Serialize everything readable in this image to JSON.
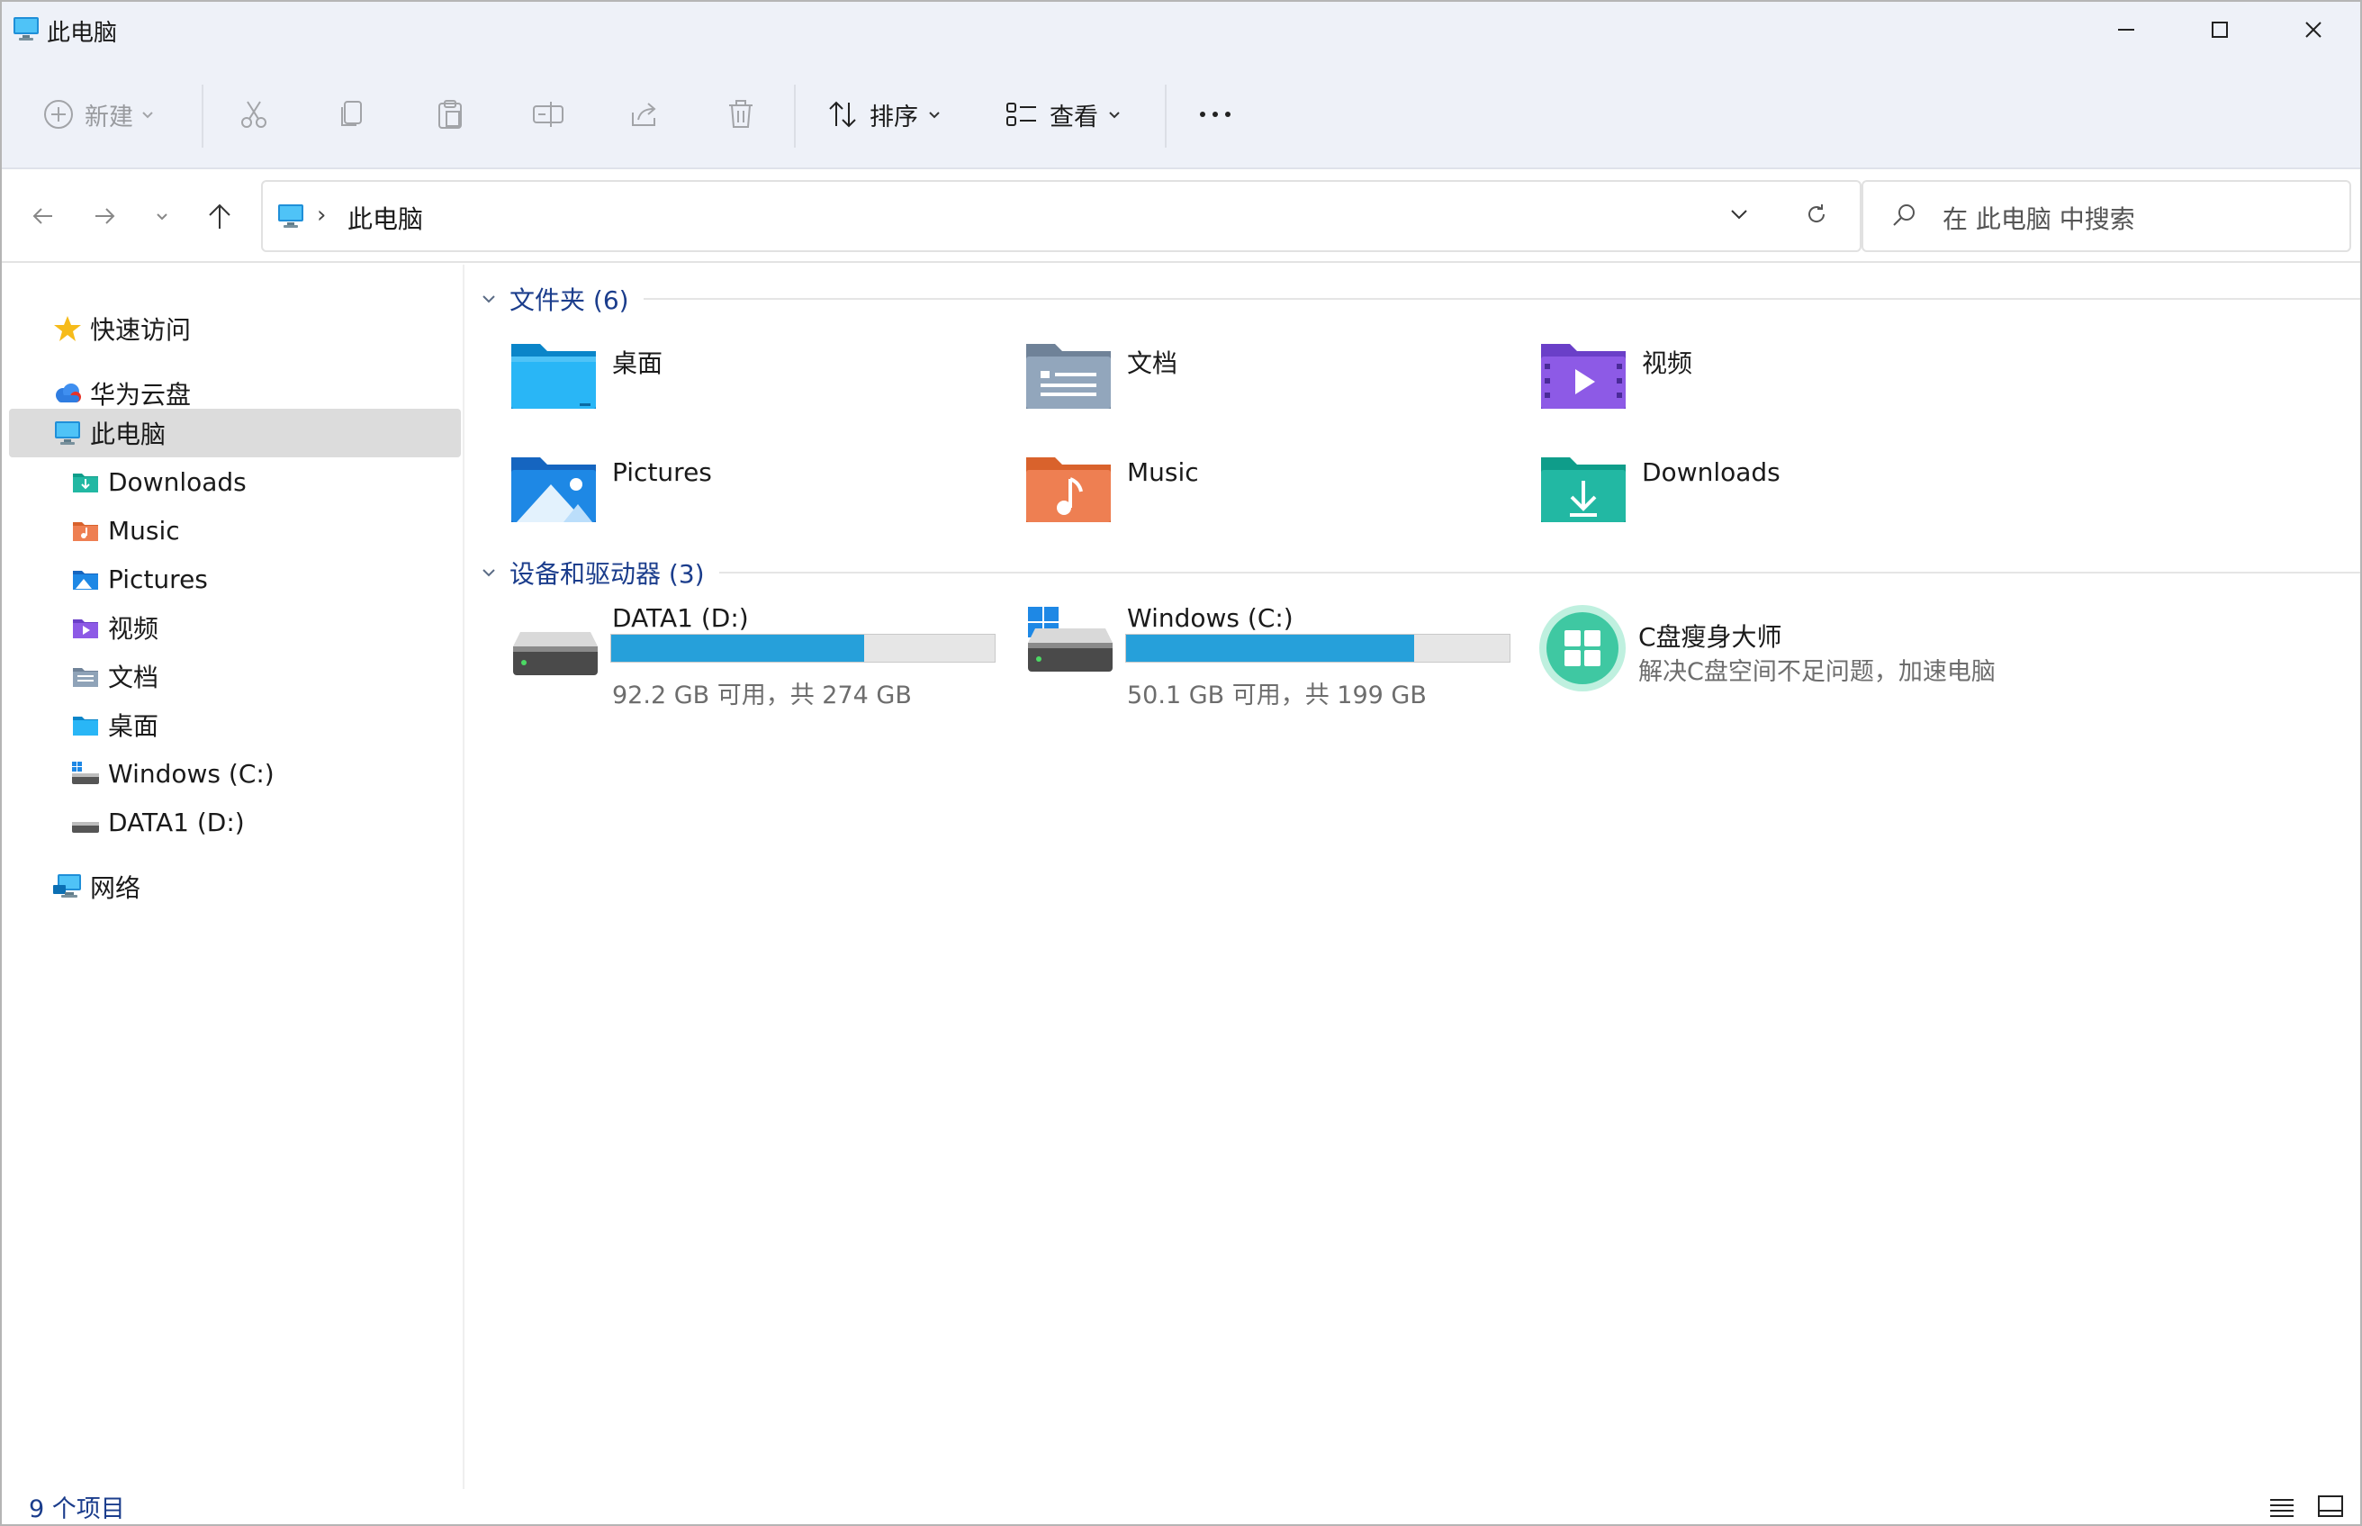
{
  "window": {
    "title": "此电脑"
  },
  "toolbar": {
    "new_label": "新建",
    "sort_label": "排序",
    "view_label": "查看"
  },
  "address": {
    "path": "此电脑"
  },
  "search": {
    "placeholder": "在 此电脑 中搜索"
  },
  "sidebar": {
    "items": [
      {
        "label": "快速访问",
        "icon": "star-icon"
      },
      {
        "label": "华为云盘",
        "icon": "cloud-icon"
      },
      {
        "label": "此电脑",
        "icon": "computer-icon",
        "selected": true
      },
      {
        "label": "Downloads",
        "icon": "downloads-folder-icon"
      },
      {
        "label": "Music",
        "icon": "music-folder-icon"
      },
      {
        "label": "Pictures",
        "icon": "pictures-folder-icon"
      },
      {
        "label": "视频",
        "icon": "videos-folder-icon"
      },
      {
        "label": "文档",
        "icon": "documents-folder-icon"
      },
      {
        "label": "桌面",
        "icon": "desktop-folder-icon"
      },
      {
        "label": "Windows (C:)",
        "icon": "system-drive-icon"
      },
      {
        "label": "DATA1 (D:)",
        "icon": "drive-icon"
      },
      {
        "label": "网络",
        "icon": "network-icon"
      }
    ]
  },
  "sections": {
    "folders_header": "文件夹 (6)",
    "drives_header": "设备和驱动器 (3)"
  },
  "folders": [
    {
      "name": "桌面",
      "icon": "desktop-folder-icon"
    },
    {
      "name": "文档",
      "icon": "documents-folder-icon"
    },
    {
      "name": "视频",
      "icon": "videos-folder-icon"
    },
    {
      "name": "Pictures",
      "icon": "pictures-folder-icon"
    },
    {
      "name": "Music",
      "icon": "music-folder-icon"
    },
    {
      "name": "Downloads",
      "icon": "downloads-folder-icon"
    }
  ],
  "drives": [
    {
      "name": "DATA1 (D:)",
      "size_text": "92.2 GB 可用，共 274 GB",
      "used_fraction": 0.66
    },
    {
      "name": "Windows (C:)",
      "size_text": "50.1 GB 可用，共 199 GB",
      "used_fraction": 0.75
    }
  ],
  "app": {
    "name": "C盘瘦身大师",
    "desc": "解决C盘空间不足问题，加速电脑"
  },
  "status": {
    "count": "9 个项目"
  },
  "colors": {
    "accent": "#1b3d8c",
    "bar_fill": "#26a0da",
    "selection": "#dcdcdc",
    "chrome": "#eef1f8"
  }
}
